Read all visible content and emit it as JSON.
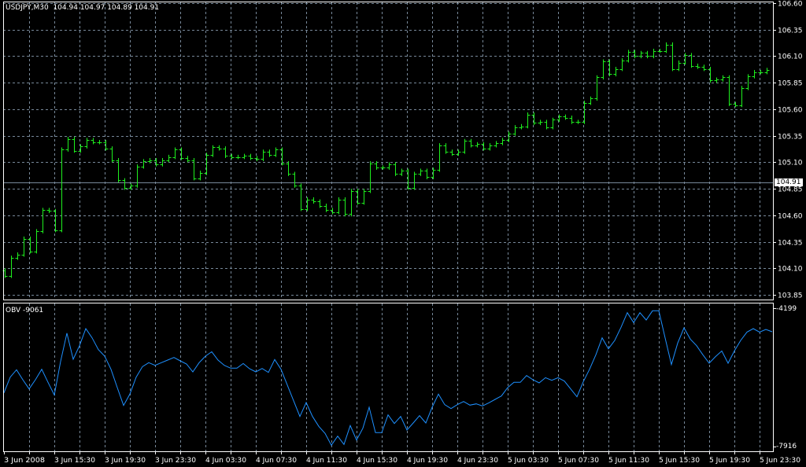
{
  "header": {
    "symbol": "USDJPY,M30",
    "open": "104.94",
    "high": "104.97",
    "low": "104.89",
    "close": "104.91"
  },
  "bid_label": "104.91",
  "indicator": {
    "label": "OBV -9061",
    "scale_max_label": "-4199",
    "scale_min_label": "-7916"
  },
  "colors": {
    "background": "#000000",
    "bars": "#1ef01e",
    "grid": "#778899",
    "obv_line": "#1e90ff",
    "bid_line": "#778899"
  },
  "chart_data": [
    {
      "type": "ohlc",
      "title": "USDJPY,M30",
      "ylim": [
        103.85,
        106.6
      ],
      "y_ticks": [
        "106.60",
        "106.35",
        "106.10",
        "105.85",
        "105.60",
        "105.35",
        "105.10",
        "104.85",
        "104.60",
        "104.35",
        "104.10",
        "103.85"
      ],
      "x_tick_labels": [
        "3 Jun 2008",
        "3 Jun 15:30",
        "3 Jun 19:30",
        "3 Jun 23:30",
        "4 Jun 03:30",
        "4 Jun 07:30",
        "4 Jun 11:30",
        "4 Jun 15:30",
        "4 Jun 19:30",
        "4 Jun 23:30",
        "5 Jun 03:30",
        "5 Jun 07:30",
        "5 Jun 11:30",
        "5 Jun 15:30",
        "5 Jun 19:30",
        "5 Jun 23:30"
      ],
      "bid": 104.91,
      "grid": true,
      "close": [
        104.03,
        104.2,
        104.23,
        104.38,
        104.26,
        104.45,
        104.65,
        104.64,
        104.46,
        105.22,
        105.32,
        105.21,
        105.25,
        105.31,
        105.29,
        105.29,
        105.23,
        105.12,
        104.93,
        104.86,
        104.88,
        105.06,
        105.11,
        105.12,
        105.08,
        105.12,
        105.15,
        105.22,
        105.14,
        105.12,
        104.95,
        105.0,
        105.17,
        105.24,
        105.23,
        105.16,
        105.15,
        105.15,
        105.16,
        105.14,
        105.13,
        105.2,
        105.17,
        105.22,
        105.09,
        104.99,
        104.88,
        104.66,
        104.75,
        104.73,
        104.69,
        104.65,
        104.63,
        104.75,
        104.61,
        104.83,
        104.72,
        104.83,
        105.09,
        105.05,
        105.05,
        105.08,
        104.99,
        105.02,
        104.86,
        104.99,
        105.02,
        104.96,
        105.03,
        105.26,
        105.2,
        105.18,
        105.2,
        105.3,
        105.26,
        105.27,
        105.23,
        105.26,
        105.28,
        105.31,
        105.37,
        105.43,
        105.44,
        105.55,
        105.47,
        105.48,
        105.43,
        105.5,
        105.53,
        105.52,
        105.48,
        105.48,
        105.66,
        105.7,
        105.9,
        106.05,
        105.93,
        105.98,
        106.06,
        106.14,
        106.1,
        106.13,
        106.1,
        106.15,
        106.15,
        106.21,
        105.98,
        106.04,
        106.11,
        106.01,
        106.0,
        105.98,
        105.87,
        105.88,
        105.9,
        105.65,
        105.64,
        105.8,
        105.91,
        105.95,
        105.95,
        105.97
      ]
    },
    {
      "type": "line",
      "title": "OBV -9061",
      "ylim": [
        -7916,
        -4199
      ],
      "values": [
        -6473,
        -6051,
        -5853,
        -6121,
        -6367,
        -6121,
        -5839,
        -6191,
        -6529,
        -5628,
        -4868,
        -5572,
        -5206,
        -4748,
        -4995,
        -5311,
        -5487,
        -5839,
        -6332,
        -6811,
        -6508,
        -6051,
        -5769,
        -5663,
        -5734,
        -5663,
        -5593,
        -5523,
        -5614,
        -5699,
        -5910,
        -5663,
        -5487,
        -5368,
        -5593,
        -5734,
        -5811,
        -5811,
        -5685,
        -5825,
        -5910,
        -5818,
        -5924,
        -5579,
        -5839,
        -6262,
        -6684,
        -7107,
        -6733,
        -7107,
        -7374,
        -7564,
        -7881,
        -7635,
        -7860,
        -7353,
        -7740,
        -7423,
        -6860,
        -7543,
        -7543,
        -7064,
        -7297,
        -7107,
        -7473,
        -7283,
        -7085,
        -7283,
        -6860,
        -6508,
        -6790,
        -6895,
        -6790,
        -6705,
        -6804,
        -6769,
        -6825,
        -6741,
        -6649,
        -6557,
        -6332,
        -6191,
        -6191,
        -6008,
        -6121,
        -6205,
        -6065,
        -6135,
        -6065,
        -6156,
        -6367,
        -6579,
        -6177,
        -5839,
        -5452,
        -4995,
        -5290,
        -5065,
        -4713,
        -4319,
        -4586,
        -4319,
        -4516,
        -4269,
        -4269,
        -4995,
        -5713,
        -5135,
        -4727,
        -5030,
        -5206,
        -5452,
        -5677,
        -5501,
        -5347,
        -5677,
        -5347,
        -5065,
        -4840,
        -4748,
        -4840,
        -4769,
        -4833
      ]
    }
  ]
}
